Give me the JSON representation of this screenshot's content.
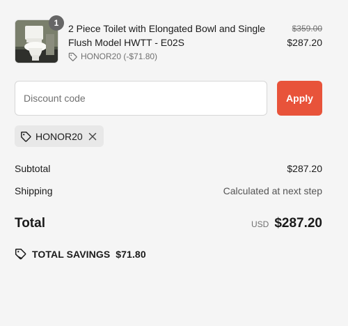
{
  "line_item": {
    "quantity": "1",
    "title": "2 Piece Toilet with Elongated Bowl and Single Flush Model HWTT - E02S",
    "discount_label": "HONOR20 (-$71.80)",
    "original_price": "$359.00",
    "price": "$287.20"
  },
  "discount": {
    "placeholder": "Discount code",
    "apply_label": "Apply",
    "applied_code": "HONOR20"
  },
  "summary": {
    "subtotal_label": "Subtotal",
    "subtotal_value": "$287.20",
    "shipping_label": "Shipping",
    "shipping_value": "Calculated at next step",
    "total_label": "Total",
    "currency": "USD",
    "total_value": "$287.20",
    "savings_label": "TOTAL SAVINGS",
    "savings_value": "$71.80"
  },
  "colors": {
    "accent": "#e8533a",
    "background": "#f5f5f5",
    "chip": "#e8e8e8"
  },
  "icons": {
    "tag": "tag-icon",
    "close": "close-icon",
    "product_image": "toilet-product-image"
  }
}
